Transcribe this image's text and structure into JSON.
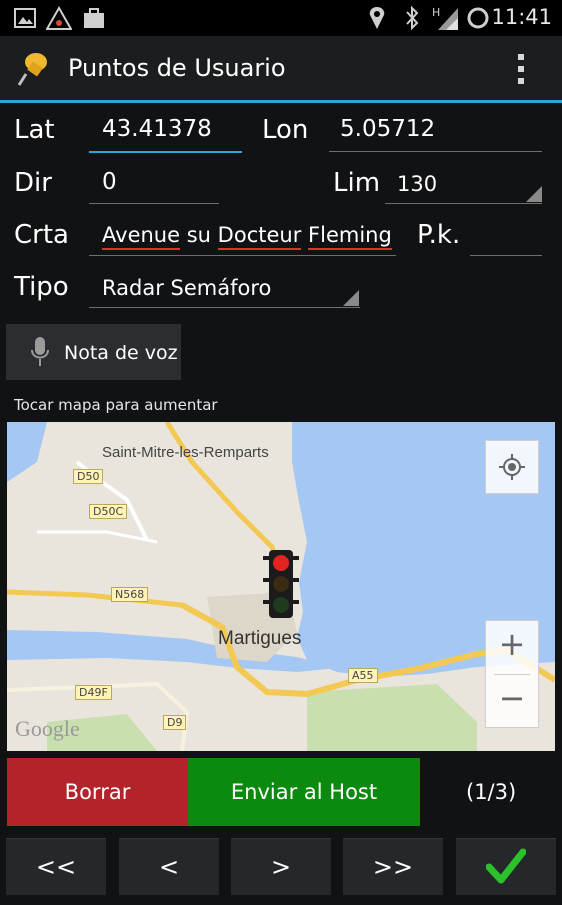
{
  "status_bar": {
    "time": "11:41"
  },
  "action_bar": {
    "title": "Puntos de Usuario"
  },
  "form": {
    "lat_label": "Lat",
    "lat_value": "43.41378",
    "lon_label": "Lon",
    "lon_value": "5.05712",
    "dir_label": "Dir",
    "dir_value": "0",
    "lim_label": "Lim",
    "lim_value": "130",
    "crta_label": "Crta",
    "crta_words": [
      "Avenue",
      "su",
      "Docteur",
      "Fleming"
    ],
    "pk_label": "P.k.",
    "pk_value": "",
    "tipo_label": "Tipo",
    "tipo_value": "Radar Semáforo"
  },
  "voice_note": {
    "label": "Nota de voz"
  },
  "map": {
    "hint": "Tocar mapa para aumentar",
    "places": [
      "Saint-Mitre-les-Remparts",
      "Martigues"
    ],
    "roads": [
      "D50",
      "D50C",
      "N568",
      "D49F",
      "D9",
      "A55"
    ],
    "logo": "Google",
    "zoom_in": "+",
    "zoom_out": "−"
  },
  "actions": {
    "delete": "Borrar",
    "send": "Enviar al Host",
    "counter": "(1/3)"
  },
  "nav": {
    "first": "<<",
    "prev": "<",
    "next": ">",
    "last": ">>"
  },
  "colors": {
    "accent": "#2aa6d8",
    "delete": "#b3232b",
    "send": "#0c8a10",
    "confirm": "#2bc12b"
  }
}
